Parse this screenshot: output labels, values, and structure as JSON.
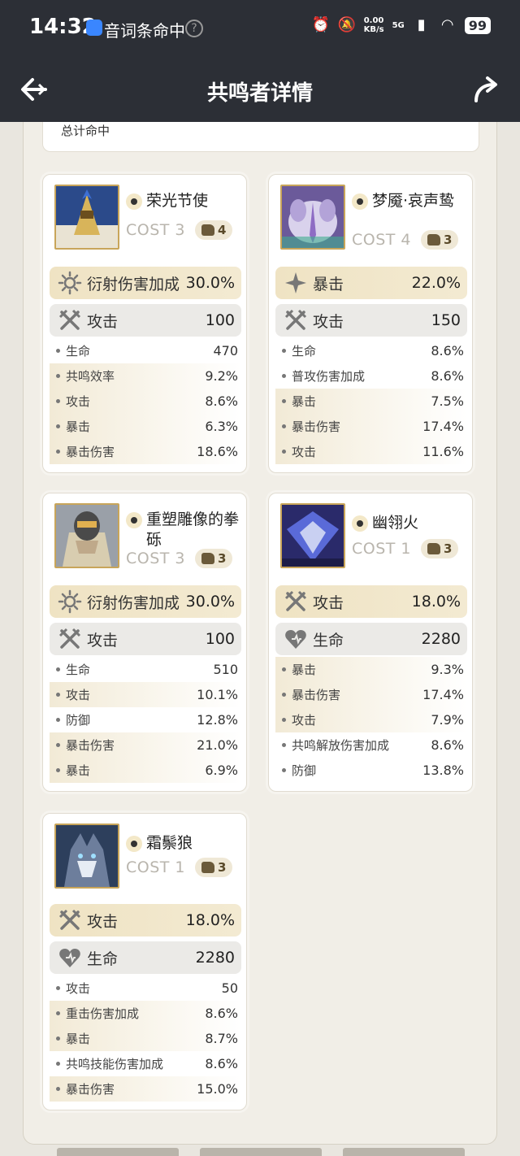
{
  "status_bar": {
    "time": "14:32",
    "status_text": "音词条命中",
    "net_speed_top": "0.00",
    "net_speed_bottom": "KB/s",
    "network": "5G",
    "battery": "99"
  },
  "header": {
    "title": "共鸣者详情"
  },
  "top_card": {
    "total_label": "总计命中"
  },
  "echoes": [
    {
      "name": "荣光节使",
      "cost": "COST 3",
      "level": "4",
      "main_stat": {
        "name": "衍射伤害加成",
        "value": "30.0%",
        "icon": "diffraction-icon"
      },
      "second_stat": {
        "name": "攻击",
        "value": "100",
        "icon": "attack-icon"
      },
      "sub_stats": [
        {
          "name": "生命",
          "value": "470"
        },
        {
          "name": "共鸣效率",
          "value": "9.2%"
        },
        {
          "name": "攻击",
          "value": "8.6%"
        },
        {
          "name": "暴击",
          "value": "6.3%"
        },
        {
          "name": "暴击伤害",
          "value": "18.6%"
        }
      ]
    },
    {
      "name": "梦魇·哀声鸷",
      "cost": "COST 4",
      "level": "3",
      "main_stat": {
        "name": "暴击",
        "value": "22.0%",
        "icon": "crit-icon"
      },
      "second_stat": {
        "name": "攻击",
        "value": "150",
        "icon": "attack-icon"
      },
      "sub_stats": [
        {
          "name": "生命",
          "value": "8.6%"
        },
        {
          "name": "普攻伤害加成",
          "value": "8.6%"
        },
        {
          "name": "暴击",
          "value": "7.5%"
        },
        {
          "name": "暴击伤害",
          "value": "17.4%"
        },
        {
          "name": "攻击",
          "value": "11.6%"
        }
      ]
    },
    {
      "name": "重塑雕像的拳砾",
      "cost": "COST 3",
      "level": "3",
      "main_stat": {
        "name": "衍射伤害加成",
        "value": "30.0%",
        "icon": "diffraction-icon"
      },
      "second_stat": {
        "name": "攻击",
        "value": "100",
        "icon": "attack-icon"
      },
      "sub_stats": [
        {
          "name": "生命",
          "value": "510"
        },
        {
          "name": "攻击",
          "value": "10.1%"
        },
        {
          "name": "防御",
          "value": "12.8%"
        },
        {
          "name": "暴击伤害",
          "value": "21.0%"
        },
        {
          "name": "暴击",
          "value": "6.9%"
        }
      ]
    },
    {
      "name": "幽翎火",
      "cost": "COST 1",
      "level": "3",
      "main_stat": {
        "name": "攻击",
        "value": "18.0%",
        "icon": "attack-icon"
      },
      "second_stat": {
        "name": "生命",
        "value": "2280",
        "icon": "hp-icon"
      },
      "sub_stats": [
        {
          "name": "暴击",
          "value": "9.3%"
        },
        {
          "name": "暴击伤害",
          "value": "17.4%"
        },
        {
          "name": "攻击",
          "value": "7.9%"
        },
        {
          "name": "共鸣解放伤害加成",
          "value": "8.6%"
        },
        {
          "name": "防御",
          "value": "13.8%"
        }
      ]
    },
    {
      "name": "霜鬃狼",
      "cost": "COST 1",
      "level": "3",
      "main_stat": {
        "name": "攻击",
        "value": "18.0%",
        "icon": "attack-icon"
      },
      "second_stat": {
        "name": "生命",
        "value": "2280",
        "icon": "hp-icon"
      },
      "sub_stats": [
        {
          "name": "攻击",
          "value": "50"
        },
        {
          "name": "重击伤害加成",
          "value": "8.6%"
        },
        {
          "name": "暴击",
          "value": "8.7%"
        },
        {
          "name": "共鸣技能伤害加成",
          "value": "8.6%"
        },
        {
          "name": "暴击伤害",
          "value": "15.0%"
        }
      ]
    }
  ]
}
